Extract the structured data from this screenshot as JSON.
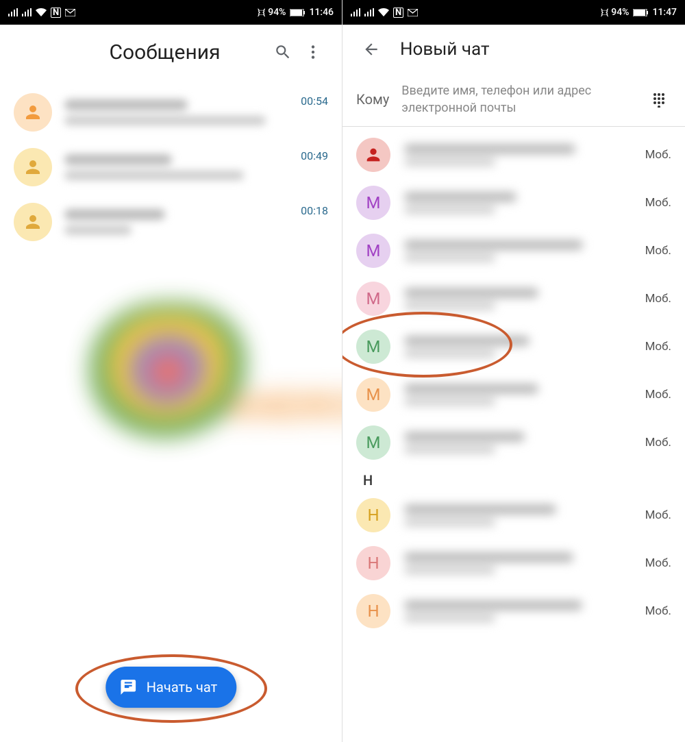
{
  "left": {
    "status": {
      "battery": "94%",
      "time": "11:46",
      "vibrate": "}□{"
    },
    "title": "Сообщения",
    "conversations": [
      {
        "time": "00:54"
      },
      {
        "time": "00:49"
      },
      {
        "time": "00:18"
      }
    ],
    "fab_label": "Начать чат"
  },
  "right": {
    "status": {
      "battery": "94%",
      "time": "11:47",
      "vibrate": "}□{"
    },
    "title": "Новый чат",
    "to_label": "Кому",
    "to_placeholder": "Введите имя, телефон или адрес электронной почты",
    "type_label": "Моб.",
    "contacts": [
      {
        "letter": "",
        "avatar_class": "av-red",
        "is_icon": true
      },
      {
        "letter": "М",
        "avatar_class": "av-purple"
      },
      {
        "letter": "М",
        "avatar_class": "av-purple"
      },
      {
        "letter": "М",
        "avatar_class": "av-pink"
      },
      {
        "letter": "М",
        "avatar_class": "av-green",
        "highlighted": true
      },
      {
        "letter": "М",
        "avatar_class": "av-orange"
      },
      {
        "letter": "М",
        "avatar_class": "av-green"
      }
    ],
    "section_letter": "Н",
    "contacts_h": [
      {
        "letter": "Н",
        "avatar_class": "av-yellow"
      },
      {
        "letter": "Н",
        "avatar_class": "av-pink2"
      },
      {
        "letter": "Н",
        "avatar_class": "av-orange"
      }
    ]
  }
}
